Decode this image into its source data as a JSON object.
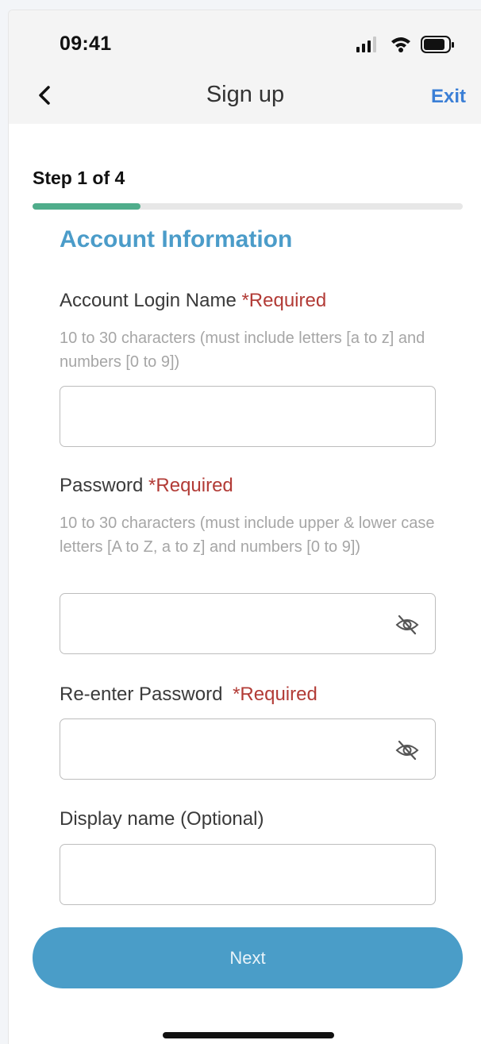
{
  "status": {
    "time": "09:41"
  },
  "nav": {
    "title": "Sign up",
    "exit_label": "Exit"
  },
  "progress": {
    "step_label": "Step 1 of 4",
    "fraction": 0.25
  },
  "form": {
    "section_title": "Account Information",
    "login": {
      "label": "Account Login Name",
      "required": "*Required",
      "hint": "10 to 30 characters (must include letters [a to z] and numbers [0 to 9])",
      "value": ""
    },
    "password": {
      "label": "Password",
      "required": "*Required",
      "hint": "10 to 30 characters (must include upper & lower case letters [A to Z, a to z] and numbers [0 to 9])",
      "value": ""
    },
    "reenter": {
      "label": "Re-enter Password",
      "required": "*Required",
      "value": ""
    },
    "display_name": {
      "label": "Display name (Optional)",
      "value": ""
    }
  },
  "actions": {
    "next_label": "Next"
  },
  "colors": {
    "accent_blue": "#4a9dc8",
    "progress_green": "#4fad8b",
    "required_red": "#b23b36",
    "exit_blue": "#3b7fd6"
  },
  "icons": {
    "back": "chevron-left-icon",
    "signal": "cellular-signal-icon",
    "wifi": "wifi-icon",
    "battery": "battery-icon",
    "eye_hidden": "eye-off-icon"
  }
}
